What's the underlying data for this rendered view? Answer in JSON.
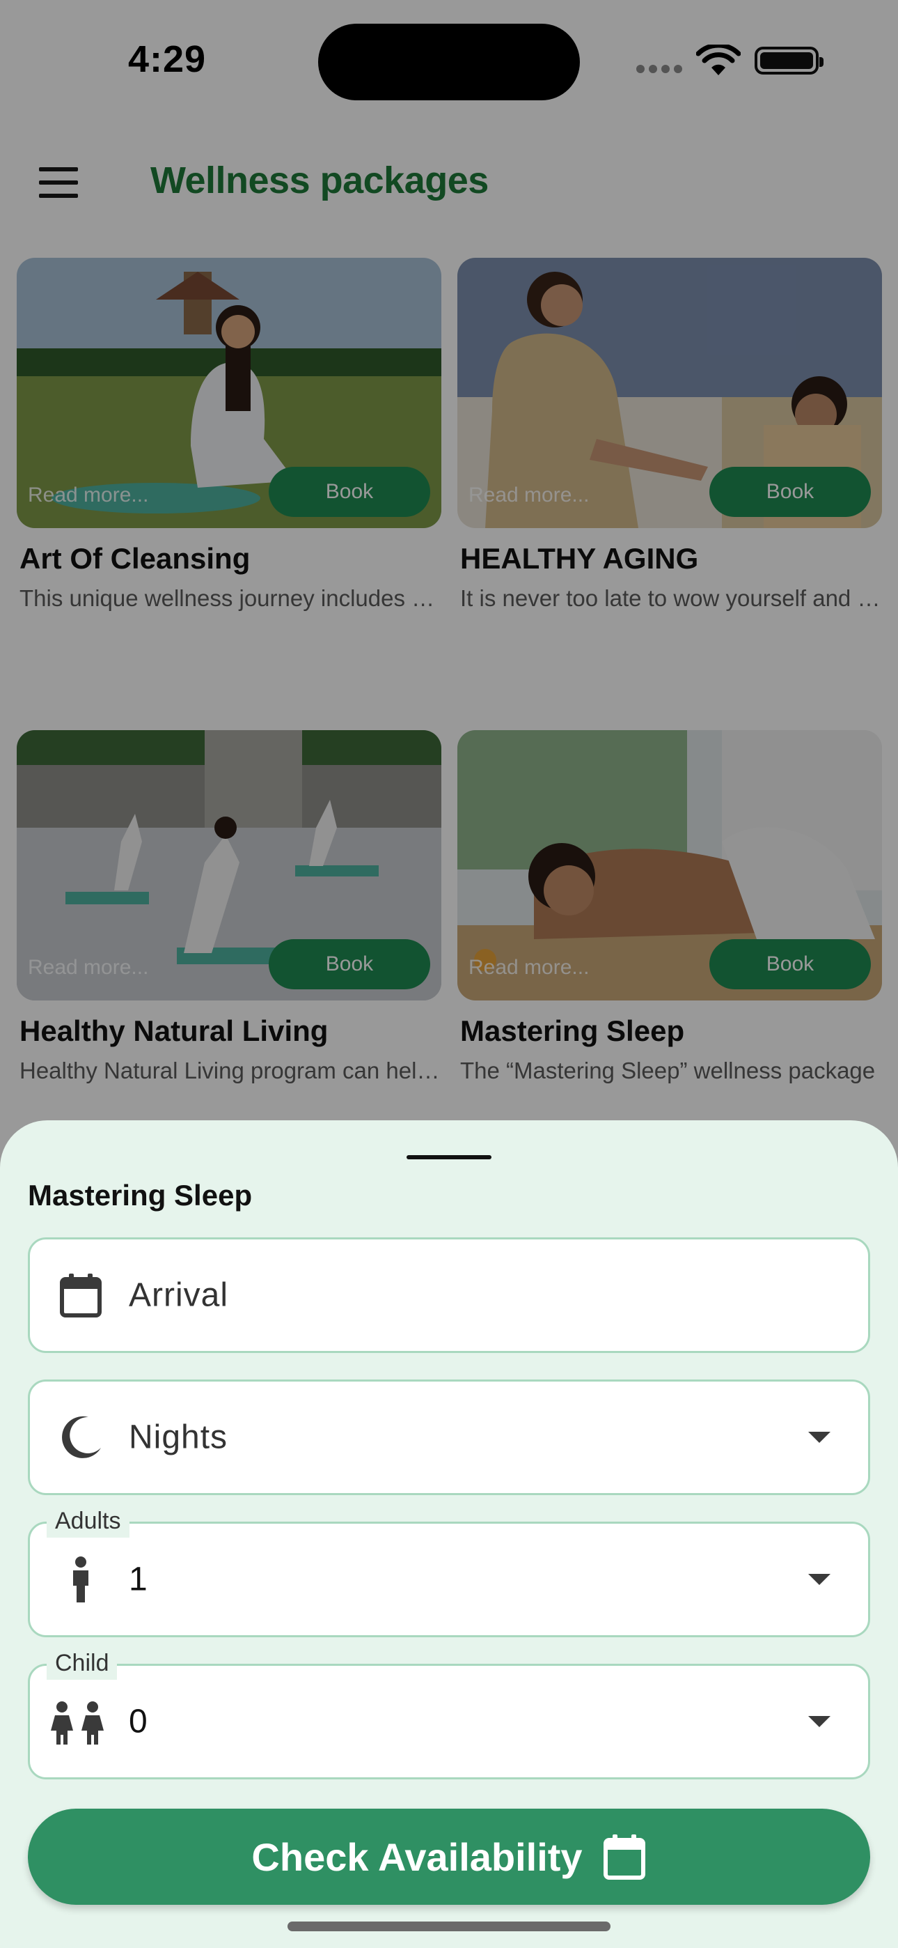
{
  "status_bar": {
    "time": "4:29"
  },
  "header": {
    "title": "Wellness packages"
  },
  "packages": [
    {
      "title": "Art Of Cleansing",
      "description": "This unique wellness journey includes a detox program",
      "read_more": "Read more...",
      "book": "Book"
    },
    {
      "title": "HEALTHY AGING",
      "description": "It is never too late to wow yourself and your body",
      "read_more": "Read more...",
      "book": "Book"
    },
    {
      "title": "Healthy Natural Living",
      "description": "Healthy Natural Living program can help you",
      "read_more": "Read more...",
      "book": "Book"
    },
    {
      "title": "Mastering Sleep",
      "description": "The “Mastering Sleep” wellness package",
      "read_more": "Read more...",
      "book": "Book"
    }
  ],
  "sheet": {
    "title": "Mastering Sleep",
    "arrival_placeholder": "Arrival",
    "nights_placeholder": "Nights",
    "adults_label": "Adults",
    "adults_value": "1",
    "child_label": "Child",
    "child_value": "0",
    "cta_label": "Check Availability"
  },
  "colors": {
    "brand_green": "#1f7a3a",
    "button_green": "#2f9063",
    "sheet_bg": "#e6f4ec",
    "field_border": "#a9d8bf"
  }
}
